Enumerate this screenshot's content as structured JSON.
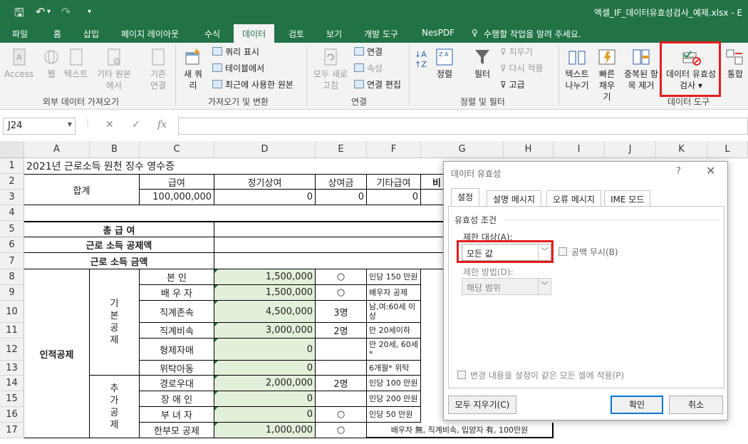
{
  "app": {
    "doc_title": "엑셀_IF_데이터유효성검사_예제.xlsx - E"
  },
  "tabs": [
    "파일",
    "홈",
    "삽입",
    "페이지 레이아웃",
    "수식",
    "데이터",
    "검토",
    "보기",
    "개발 도구",
    "NesPDF"
  ],
  "tell_me": "수행할 작업을 알려 주세요.",
  "ribbon": {
    "external": {
      "access": "Access",
      "web": "웹",
      "text": "텍스트",
      "other": "기타 원본에서",
      "existing": "기존 연결",
      "group": "외부 데이터 가져오기"
    },
    "getdata": {
      "newquery": "새 쿼리",
      "show": "쿼리 표시",
      "table": "테이블에서",
      "recent": "최근에 사용한 원본",
      "group": "가져오기 및 변환"
    },
    "conn": {
      "refresh": "모두 새로 고침",
      "conn": "연결",
      "props": "속성",
      "edit": "연결 편집",
      "group": "연결"
    },
    "sort": {
      "sort": "정렬",
      "filter": "필터",
      "clear": "지우기",
      "reapply": "다시 적용",
      "advanced": "고급",
      "group": "정렬 및 필터"
    },
    "tools": {
      "text2col": "텍스트 나누기",
      "flash": "빠른 채우기",
      "dup": "중복된 항목 제거",
      "valid": "데이터 유효성 검사",
      "consolidate": "통합",
      "group": "데이터 도구"
    }
  },
  "formula_bar": {
    "name_box": "J24",
    "fx": "fx"
  },
  "columns": [
    "A",
    "B",
    "C",
    "D",
    "E",
    "F",
    "G",
    "H",
    "I",
    "J",
    "K",
    "L"
  ],
  "rows": [
    "1",
    "2",
    "3",
    "4",
    "5",
    "6",
    "7",
    "8",
    "9",
    "10",
    "11",
    "12",
    "13",
    "14",
    "15",
    "16",
    "17"
  ],
  "sheet": {
    "title": "2021년 근로소득 원천 징수 영수증",
    "total": "합계",
    "pay": "급여",
    "bonus": "정기상여",
    "bonus2": "상여금",
    "other_pay": "기타급여",
    "trunc": "비",
    "pay_val": "100,000,000",
    "zero": "0",
    "gross": "총 급 여",
    "deduct": "근로 소득 공제액",
    "income": "근로 소득 금액",
    "personal": "인적공제",
    "basic": "기본공제",
    "extra": "추가공제",
    "items": [
      {
        "name": "본 인",
        "amt": "1,500,000",
        "cnt": "○",
        "note": "인당 150 만원"
      },
      {
        "name": "배 우 자",
        "amt": "1,500,000",
        "cnt": "○",
        "note": "배우자 공제"
      },
      {
        "name": "직계존속",
        "amt": "4,500,000",
        "cnt": "3명",
        "note": "남,여:60세 이상"
      },
      {
        "name": "직계비속",
        "amt": "3,000,000",
        "cnt": "2명",
        "note": "만 20세이하"
      },
      {
        "name": "형제자매",
        "amt": "0",
        "cnt": "",
        "note": "만 20세, 60세*"
      },
      {
        "name": "위탁아동",
        "amt": "0",
        "cnt": "",
        "note": "6개월* 위탁"
      },
      {
        "name": "경로우대",
        "amt": "2,000,000",
        "cnt": "2명",
        "note": "인당 100 만원"
      },
      {
        "name": "장 애 인",
        "amt": "0",
        "cnt": "",
        "note": "인당 200 만원"
      },
      {
        "name": "부 녀 자",
        "amt": "0",
        "cnt": "○",
        "note": "인당 50 만원"
      },
      {
        "name": "한부모 공제",
        "amt": "1,000,000",
        "cnt": "○",
        "note": "배우자 無, 직계비속, 입양자 有, 100만원"
      }
    ]
  },
  "dialog": {
    "title": "데이터 유효성",
    "help": "?",
    "close": "✕",
    "tabs": [
      "설정",
      "설명 메시지",
      "오류 메시지",
      "IME 모드"
    ],
    "criteria": "유효성 조건",
    "allow_label": "제한 대상(A):",
    "allow_value": "모든 값",
    "ignore_blank": "공백 무시(B)",
    "data_label": "제한 방법(D):",
    "data_value": "해당 범위",
    "apply_all": "변경 내용을 설정이 같은 모든 셀에 적용(P)",
    "clear_all": "모두 지우기(C)",
    "ok": "확인",
    "cancel": "취소"
  },
  "colors": {
    "excel_green": "#217346",
    "input_fill": "#e2efda",
    "highlight": "#e41d1d"
  }
}
